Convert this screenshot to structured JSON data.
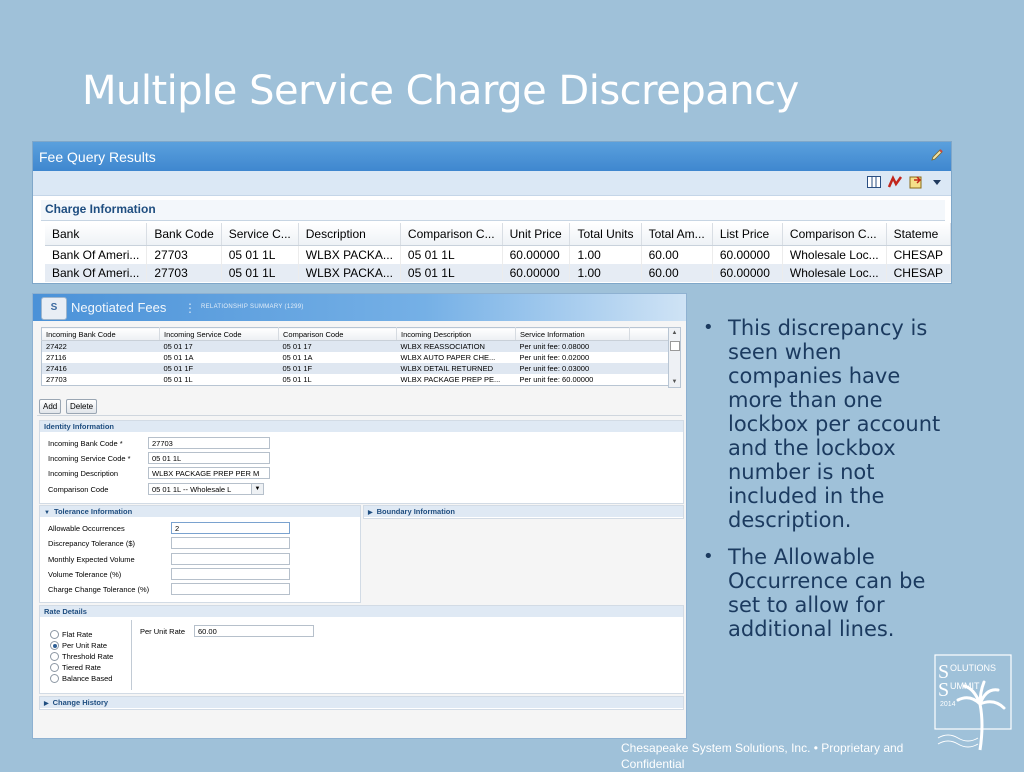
{
  "slide": {
    "title": "Multiple Service Charge Discrepancy"
  },
  "fee_query": {
    "title": "Fee Query Results",
    "section": "Charge Information",
    "columns": [
      "Bank",
      "Bank Code",
      "Service C...",
      "Description",
      "Comparison C...",
      "Unit Price",
      "Total Units",
      "Total Am...",
      "List Price",
      "Comparison C...",
      "Stateme"
    ],
    "rows": [
      [
        "Bank Of Ameri...",
        "27703",
        "05 01 1L",
        "WLBX PACKA...",
        "05 01 1L",
        "60.00000",
        "1.00",
        "60.00",
        "60.00000",
        "Wholesale Loc...",
        "CHESAP"
      ],
      [
        "Bank Of Ameri...",
        "27703",
        "05 01 1L",
        "WLBX PACKA...",
        "05 01 1L",
        "60.00000",
        "1.00",
        "60.00",
        "60.00000",
        "Wholesale Loc...",
        "CHESAP"
      ]
    ]
  },
  "negotiated": {
    "title": "Negotiated Fees",
    "subtitle": "RELATIONSHIP SUMMARY (1299)",
    "columns": [
      "Incoming Bank Code",
      "Incoming Service Code",
      "Comparison Code",
      "Incoming Description",
      "Service Information"
    ],
    "rows": [
      [
        "27422",
        "05 01 17",
        "05 01 17",
        "WLBX REASSOCIATION",
        "Per unit fee: 0.08000"
      ],
      [
        "27116",
        "05 01 1A",
        "05 01 1A",
        "WLBX AUTO PAPER CHE...",
        "Per unit fee: 0.02000"
      ],
      [
        "27416",
        "05 01 1F",
        "05 01 1F",
        "WLBX DETAIL RETURNED",
        "Per unit fee: 0.03000"
      ],
      [
        "27703",
        "05 01 1L",
        "05 01 1L",
        "WLBX PACKAGE PREP PE...",
        "Per unit fee: 60.00000"
      ]
    ],
    "add_label": "Add",
    "delete_label": "Delete",
    "identity": {
      "head": "Identity Information",
      "bank_code_label": "Incoming Bank Code *",
      "bank_code": "27703",
      "service_code_label": "Incoming Service Code *",
      "service_code": "05 01 1L",
      "description_label": "Incoming Description",
      "description": "WLBX PACKAGE PREP PER M",
      "comparison_label": "Comparison Code",
      "comparison": "05 01 1L -- Wholesale L"
    },
    "tolerance": {
      "head": "Tolerance Information",
      "allowable_label": "Allowable Occurrences",
      "allowable": "2",
      "discrepancy_label": "Discrepancy Tolerance ($)",
      "monthly_label": "Monthly Expected Volume",
      "volume_label": "Volume Tolerance (%)",
      "charge_label": "Charge Change Tolerance (%)"
    },
    "boundary_head": "Boundary Information",
    "rate": {
      "head": "Rate Details",
      "options": [
        "Flat Rate",
        "Per Unit Rate",
        "Threshold Rate",
        "Tiered Rate",
        "Balance Based"
      ],
      "selected": "Per Unit Rate",
      "per_unit_label": "Per Unit Rate",
      "per_unit_value": "60.00"
    },
    "history_head": "Change History"
  },
  "bullets": [
    "This discrepancy is seen when companies have more than one lockbox per account and the lockbox number is not included in the description.",
    "The Allowable Occurrence can be  set to allow for additional lines."
  ],
  "footer": "Chesapeake System Solutions, Inc.  •  Proprietary and Confidential",
  "logo": {
    "line1": "OLUTIONS",
    "line2": "UMMIT",
    "year": "2014"
  },
  "colors": {
    "background": "#9fc1d9",
    "titlebar": "#4b92d8",
    "text_dark": "#1b3a5f"
  }
}
